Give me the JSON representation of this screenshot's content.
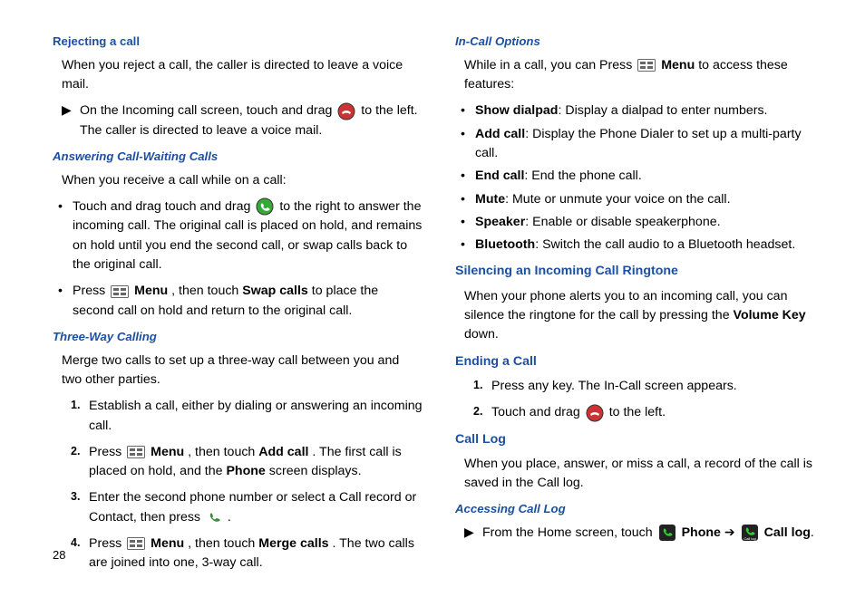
{
  "page_number": "28",
  "left": {
    "h1": "Rejecting a call",
    "p1": "When you reject a call, the caller is directed to leave a voice mail.",
    "l1a": "On the Incoming call screen, touch and drag ",
    "l1b": " to the left. The caller is directed to leave a voice mail.",
    "h2": "Answering Call-Waiting Calls",
    "p2": "When you receive a call while on a call:",
    "l2a": "Touch and drag touch and drag ",
    "l2b": " to the right to answer the incoming call. The original call is placed on hold, and remains on hold until you end the second call, or swap calls back to the original call.",
    "l3a": "Press ",
    "l3b_bold": "Menu",
    "l3c": ", then touch ",
    "l3d_bold": "Swap calls",
    "l3e": " to place the second call on hold and return to the original call.",
    "h3": "Three-Way Calling",
    "p3": "Merge two calls to set up a three-way call between you and two other parties.",
    "n1": "Establish a call, either by dialing or answering an incoming call.",
    "n2a": "Press ",
    "n2b_bold": "Menu",
    "n2c": ", then touch ",
    "n2d_bold": "Add call",
    "n2e": ". The first call is placed on hold, and the ",
    "n2f_bold": "Phone",
    "n2g": " screen displays.",
    "n3a": "Enter the second phone number or select a Call record or Contact, then press ",
    "n3b": ".",
    "n4a": "Press ",
    "n4b_bold": "Menu",
    "n4c": ", then touch ",
    "n4d_bold": "Merge calls",
    "n4e": ". The two calls are joined into one, 3-way call."
  },
  "right": {
    "h1": "In-Call Options",
    "p1a": "While in a call, you can Press ",
    "p1b_bold": "Menu",
    "p1c": " to access these features:",
    "b1a_bold": "Show dialpad",
    "b1b": ": Display a dialpad to enter numbers.",
    "b2a_bold": "Add call",
    "b2b": ": Display the Phone Dialer to set up a multi-party call.",
    "b3a_bold": "End call",
    "b3b": ": End the phone call.",
    "b4a_bold": "Mute",
    "b4b": ": Mute or unmute your voice on the call.",
    "b5a_bold": "Speaker",
    "b5b": ": Enable or disable speakerphone.",
    "b6a_bold": "Bluetooth",
    "b6b": ": Switch the call audio to a Bluetooth headset.",
    "h2": "Silencing an Incoming Call Ringtone",
    "p2a": "When your phone alerts you to an incoming call, you can silence the ringtone for the call by pressing the ",
    "p2b_bold": "Volume Key",
    "p2c": " down.",
    "h3": "Ending a Call",
    "e1": "Press any key. The In-Call screen appears.",
    "e2a": "Touch and drag ",
    "e2b": " to the left.",
    "h4": "Call Log",
    "p4": "When you place, answer, or miss a call, a record of the call is saved in the Call log.",
    "h5": "Accessing Call Log",
    "a1a": "From the Home screen, touch ",
    "a1b_bold": "Phone",
    "a1c": " ➔ ",
    "a1d_bold": "Call log",
    "a1e": "."
  }
}
